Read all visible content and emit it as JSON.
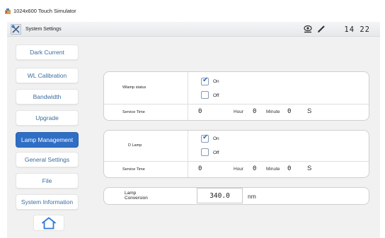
{
  "window": {
    "title": "1024x600 Touch Simulator"
  },
  "header": {
    "title": "System Settings",
    "clock": "14 22",
    "status_icons": [
      "camera-icon",
      "pen-icon"
    ]
  },
  "sidebar": {
    "items": [
      {
        "label": "Dark Current",
        "active": false
      },
      {
        "label": "WL Calibration",
        "active": false
      },
      {
        "label": "Bandwidth",
        "active": false
      },
      {
        "label": "Upgrade",
        "active": false
      },
      {
        "label": "Lamp Management",
        "active": true
      },
      {
        "label": "General Settings",
        "active": false
      },
      {
        "label": "File",
        "active": false
      },
      {
        "label": "System Information",
        "active": false
      }
    ],
    "home_icon": "home-icon"
  },
  "lamps": {
    "w": {
      "label": "Wlamp status",
      "on_label": "On",
      "on_checked": true,
      "off_label": "Off",
      "off_checked": false,
      "service_label": "Service Time",
      "hour_value": "0",
      "hour_label": "Hour",
      "minute_value": "0",
      "minute_label": "Minute",
      "second_value": "0",
      "second_label": "S"
    },
    "d": {
      "label": "D Lamp",
      "on_label": "On",
      "on_checked": true,
      "off_label": "Off",
      "off_checked": false,
      "service_label": "Service Time",
      "hour_value": "0",
      "hour_label": "Hour",
      "minute_value": "0",
      "minute_label": "Minute",
      "second_value": "0",
      "second_label": "S"
    }
  },
  "conversion": {
    "label_line1": "Lamp",
    "label_line2": "Conversion",
    "value": "340.0",
    "unit": "nm"
  }
}
